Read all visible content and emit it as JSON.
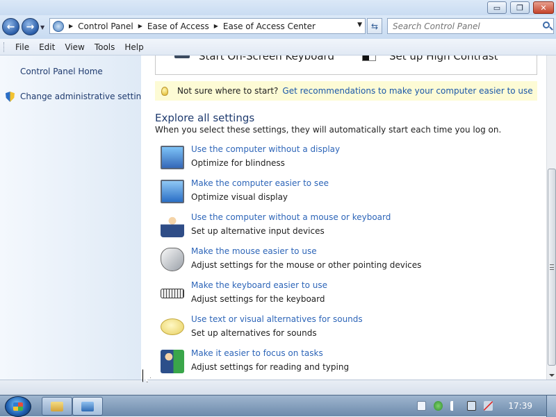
{
  "window": {
    "controls": {
      "minimize": "▭",
      "maximize": "❐",
      "close": "✕"
    }
  },
  "address_bar": {
    "breadcrumbs": [
      "Control Panel",
      "Ease of Access",
      "Ease of Access Center"
    ],
    "search_placeholder": "Search Control Panel"
  },
  "menu": {
    "items": [
      "File",
      "Edit",
      "View",
      "Tools",
      "Help"
    ]
  },
  "left_nav": {
    "items": [
      {
        "label": "Control Panel Home"
      },
      {
        "label": "Change administrative settings",
        "icon": "shield-icon"
      }
    ]
  },
  "quick_access": {
    "items": [
      {
        "label": "Start On-Screen Keyboard",
        "icon": "keyboard-icon"
      },
      {
        "label": "Set up High Contrast",
        "icon": "contrast-icon"
      }
    ]
  },
  "tip": {
    "text": "Not sure where to start?",
    "link": "Get recommendations to make your computer easier to use"
  },
  "explore": {
    "title": "Explore all settings",
    "subtitle": "When you select these settings, they will automatically start each time you log on.",
    "settings": [
      {
        "link": "Use the computer without a display",
        "desc": "Optimize for blindness",
        "icon": "display-speaker-icon"
      },
      {
        "link": "Make the computer easier to see",
        "desc": "Optimize visual display",
        "icon": "magnifier-icon"
      },
      {
        "link": "Use the computer without a mouse or keyboard",
        "desc": "Set up alternative input devices",
        "icon": "person-icon"
      },
      {
        "link": "Make the mouse easier to use",
        "desc": "Adjust settings for the mouse or other pointing devices",
        "icon": "mouse-icon"
      },
      {
        "link": "Make the keyboard easier to use",
        "desc": "Adjust settings for the keyboard",
        "icon": "keyboard-icon"
      },
      {
        "link": "Use text or visual alternatives for sounds",
        "desc": "Set up alternatives for sounds",
        "icon": "speech-bubble-icon"
      },
      {
        "link": "Make it easier to focus on tasks",
        "desc": "Adjust settings for reading and typing",
        "icon": "focus-icon"
      }
    ]
  },
  "taskbar": {
    "clock": "17:39"
  },
  "colors": {
    "link": "#2d65b8",
    "tip_background": "#fdfbd5",
    "taskbar": "#7f9ab8"
  }
}
